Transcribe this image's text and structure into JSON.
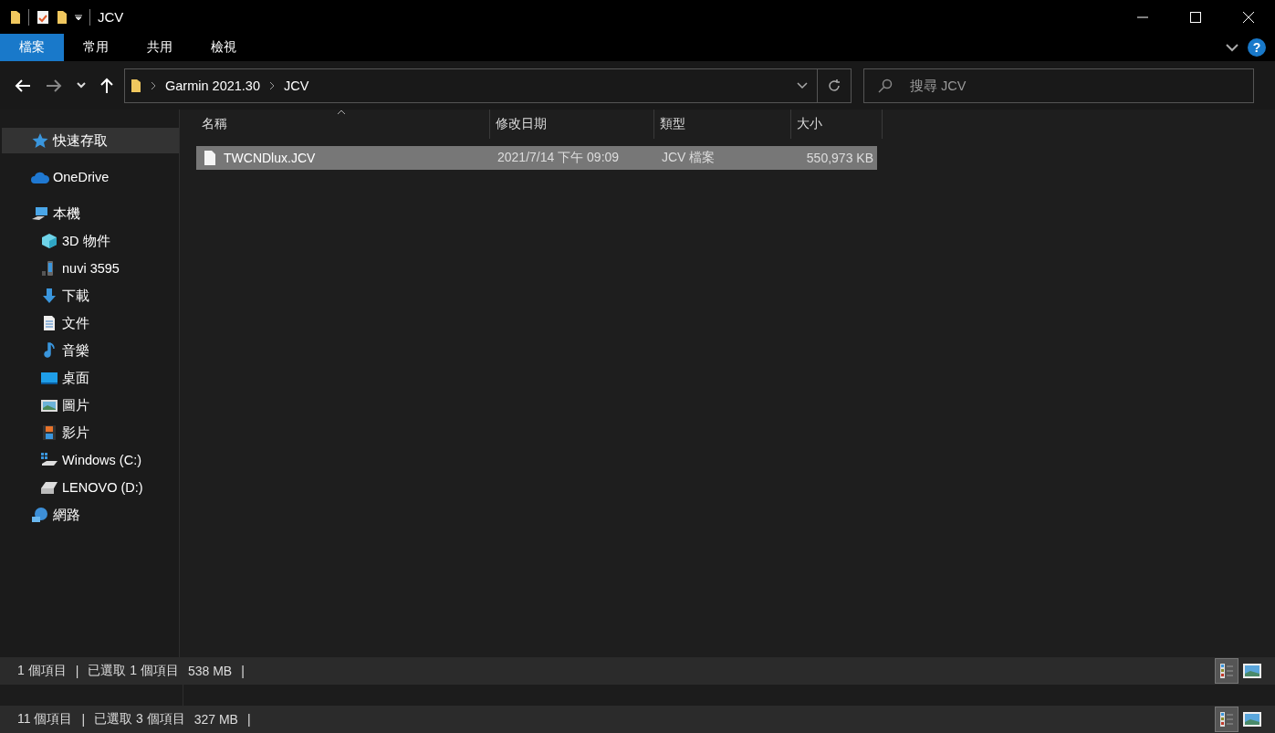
{
  "window": {
    "title": "JCV",
    "help": "?"
  },
  "ribbon_tabs": [
    {
      "label": "檔案",
      "selected": true
    },
    {
      "label": "常用",
      "selected": false
    },
    {
      "label": "共用",
      "selected": false
    },
    {
      "label": "檢視",
      "selected": false
    }
  ],
  "address_bar": {
    "path": [
      "Garmin 2021.30",
      "JCV"
    ]
  },
  "search": {
    "placeholder": "搜尋 JCV"
  },
  "sidebar": {
    "items": [
      {
        "label": "快速存取",
        "selected": true
      },
      {
        "label": "OneDrive",
        "selected": false
      },
      {
        "label": "本機",
        "selected": false,
        "children": [
          {
            "label": "3D 物件",
            "selected": false
          },
          {
            "label": "nuvi 3595",
            "selected": false
          },
          {
            "label": "下載",
            "selected": false
          },
          {
            "label": "文件",
            "selected": false
          },
          {
            "label": "音樂",
            "selected": false
          },
          {
            "label": "桌面",
            "selected": false
          },
          {
            "label": "圖片",
            "selected": false
          },
          {
            "label": "影片",
            "selected": false
          },
          {
            "label": "Windows (C:)",
            "selected": false
          },
          {
            "label": "LENOVO (D:)",
            "selected": false
          }
        ]
      },
      {
        "label": "網路",
        "selected": false
      }
    ]
  },
  "file_list": {
    "columns": [
      "名稱",
      "修改日期",
      "類型",
      "大小"
    ],
    "rows": [
      {
        "cells": [
          "TWCNDlux.JCV",
          "2021/7/14 下午 09:09",
          "JCV 檔案",
          "550,973 KB"
        ],
        "selected": true
      }
    ]
  },
  "status_bar": {
    "items": [
      "1 個項目",
      "|",
      "已選取 1 個項目",
      "538 MB",
      "|"
    ],
    "view_buttons": [
      {
        "selected": true
      },
      {
        "selected": false
      }
    ]
  },
  "background_window": {
    "status_bar": {
      "items": [
        "11 個項目",
        "|",
        "已選取 3 個項目",
        "327 MB",
        "|"
      ],
      "view_buttons": [
        {
          "selected": true
        },
        {
          "selected": false
        }
      ]
    }
  }
}
